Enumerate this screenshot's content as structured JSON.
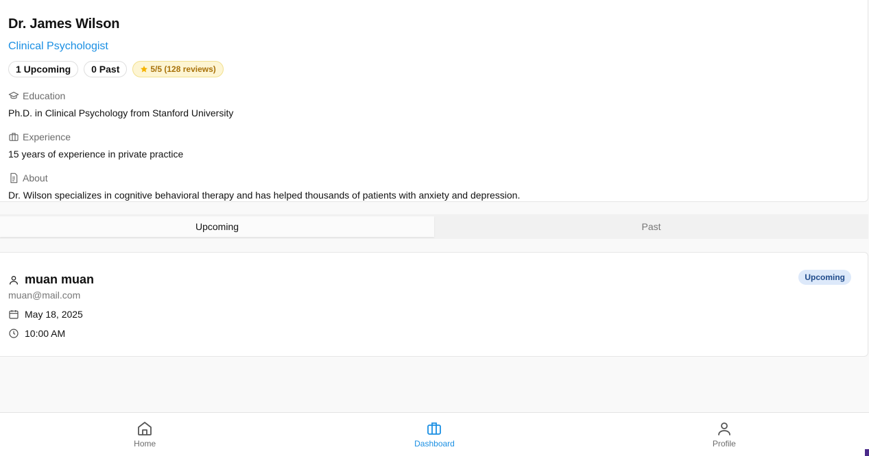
{
  "doctor": {
    "name": "Dr. James Wilson",
    "title": "Clinical Psychologist",
    "upcoming_chip": "1 Upcoming",
    "past_chip": "0 Past",
    "rating_chip": "5/5 (128 reviews)"
  },
  "sections": {
    "education": {
      "label": "Education",
      "icon": "graduation-cap-icon",
      "text": "Ph.D. in Clinical Psychology from Stanford University"
    },
    "experience": {
      "label": "Experience",
      "icon": "briefcase-icon",
      "text": "15 years of experience in private practice"
    },
    "about": {
      "label": "About",
      "icon": "document-icon",
      "text": "Dr. Wilson specializes in cognitive behavioral therapy and has helped thousands of patients with anxiety and depression."
    }
  },
  "tabs": [
    {
      "label": "Upcoming",
      "active": true
    },
    {
      "label": "Past",
      "active": false
    }
  ],
  "appointment": {
    "patient_name": "muan muan",
    "email": "muan@mail.com",
    "date": "May 18, 2025",
    "time": "10:00 AM",
    "status": "Upcoming"
  },
  "nav": [
    {
      "label": "Home",
      "icon": "home-icon",
      "active": false
    },
    {
      "label": "Dashboard",
      "icon": "briefcase-icon",
      "active": true
    },
    {
      "label": "Profile",
      "icon": "user-icon",
      "active": false
    }
  ],
  "colors": {
    "accent": "#1a8fe3",
    "rating_bg": "#fdf5d3",
    "rating_text": "#a8720a",
    "badge_bg": "#dde9fa",
    "badge_text": "#1f4a8a"
  }
}
